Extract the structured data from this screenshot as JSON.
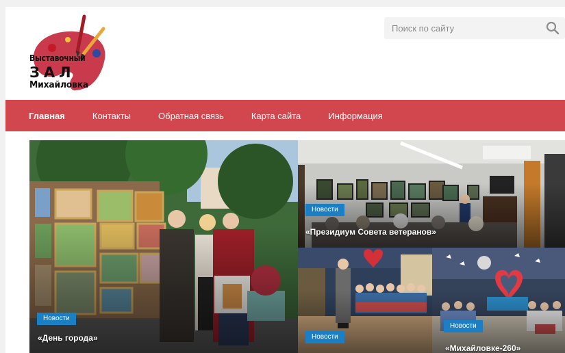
{
  "logo": {
    "line1": "Выставочный",
    "line2": "ЗАЛ",
    "line3": "Михайловка"
  },
  "search": {
    "placeholder": "Поиск по сайту",
    "icon": "search-icon"
  },
  "nav": {
    "items": [
      "Главная",
      "Контакты",
      "Обратная связь",
      "Карта сайта",
      "Информация"
    ],
    "active": "Главная"
  },
  "colors": {
    "nav_bg": "#d2464d",
    "badge_bg": "#1a7fc4"
  },
  "news": [
    {
      "badge": "Новости",
      "title": "«День города»"
    },
    {
      "badge": "Новости",
      "title": "«Президиум Совета ветеранов»"
    },
    {
      "badge": "Новости",
      "title": ""
    },
    {
      "badge": "Новости",
      "title": "«Михайловке-260»"
    }
  ]
}
